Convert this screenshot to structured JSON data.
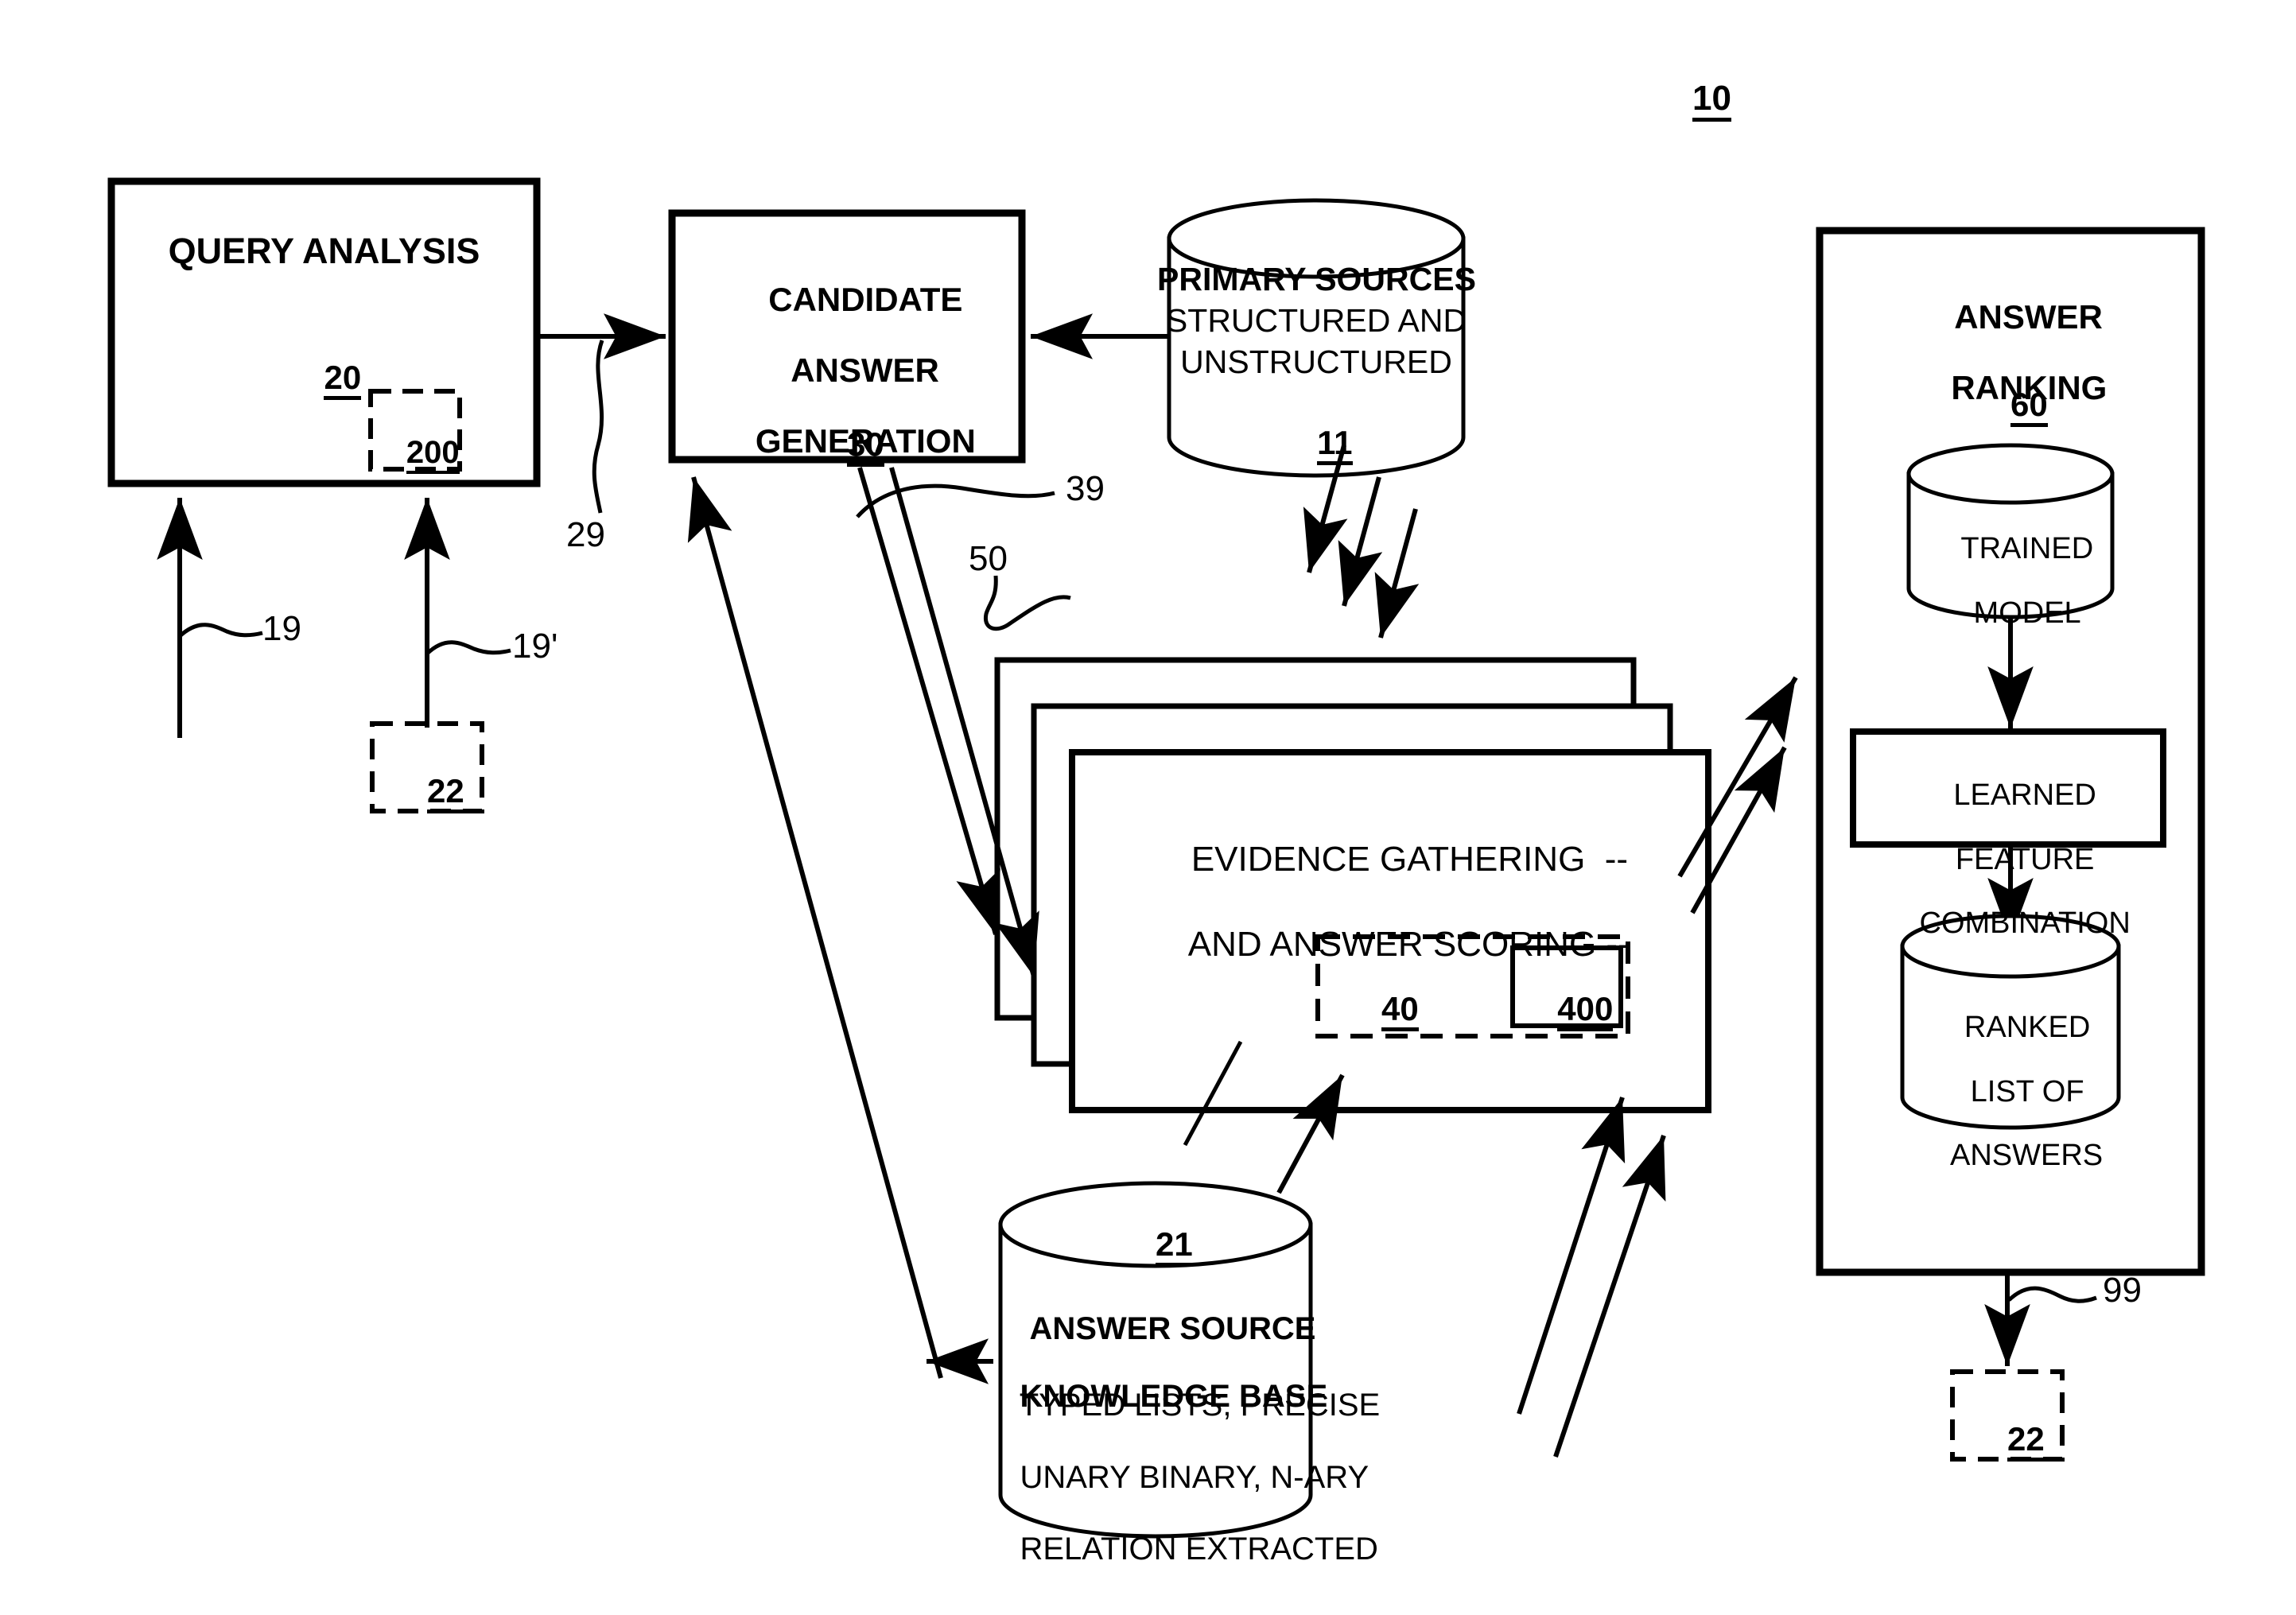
{
  "figure": {
    "number": "10"
  },
  "blocks": {
    "query_analysis": {
      "title": "QUERY ANALYSIS",
      "ref": "20",
      "inner_ref": "200"
    },
    "candidate_answer_generation": {
      "title_line1": "CANDIDATE",
      "title_line2": "ANSWER",
      "title_line3": "GENERATION",
      "ref": "30"
    },
    "primary_sources": {
      "title": "PRIMARY SOURCES",
      "line2": "STRUCTURED AND",
      "line3": "UNSTRUCTURED",
      "ref": "11"
    },
    "answer_ranking": {
      "title_line1": "ANSWER",
      "title_line2": "RANKING",
      "ref": "60",
      "trained_model_line1": "TRAINED",
      "trained_model_line2": "MODEL",
      "learned_feature_line1": "LEARNED",
      "learned_feature_line2": "FEATURE",
      "learned_feature_line3": "COMBINATION",
      "ranked_list_line1": "RANKED",
      "ranked_list_line2": "LIST OF",
      "ranked_list_line3": "ANSWERS"
    },
    "evidence_gathering": {
      "line1": "EVIDENCE GATHERING  --",
      "line2": "AND ANSWER SCORING --",
      "ref_outer": "40",
      "ref_inner": "400"
    },
    "answer_source_kb": {
      "ref_top": "21",
      "title_line1": "ANSWER SOURCE",
      "title_line2": "KNOWLEDGE BASE",
      "line3": "TYPED LISTS, PRECISE",
      "line4": "UNARY BINARY, N-ARY",
      "line5": "RELATION EXTRACTED"
    },
    "input_box_22": {
      "ref": "22"
    },
    "output_box_22": {
      "ref": "22"
    }
  },
  "leaders": {
    "query_input_19": "19",
    "query_input_19_prime": "19'",
    "query_to_cag_29": "29",
    "cag_to_evidence_39": "39",
    "evidence_stack_50": "50",
    "ranking_output_99": "99"
  },
  "colors": {
    "stroke": "#000000",
    "background": "#ffffff"
  }
}
